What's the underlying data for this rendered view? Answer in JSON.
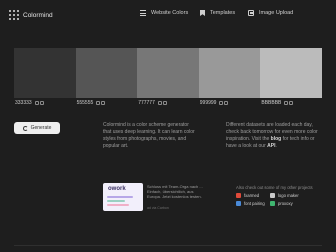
{
  "brand": {
    "name": "Colormind"
  },
  "nav": [
    {
      "label": "Website Colors",
      "icon": "list-icon"
    },
    {
      "label": "Templates",
      "icon": "bookmark-icon"
    },
    {
      "label": "Image Upload",
      "icon": "image-icon"
    }
  ],
  "palette": {
    "swatches": [
      {
        "color": "#333333",
        "hex": "333333"
      },
      {
        "color": "#555555",
        "hex": "555555"
      },
      {
        "color": "#777777",
        "hex": "777777"
      },
      {
        "color": "#999999",
        "hex": "999999"
      },
      {
        "color": "#BBBBBB",
        "hex": "BBBBBB"
      }
    ]
  },
  "generate": {
    "label": "Generate",
    "icon": "refresh-icon"
  },
  "description": {
    "left": "Colormind is a color scheme generator that uses deep learning. It can learn color styles from photographs, movies, and popular art.",
    "right_pre": "Different datasets are loaded each day, check back tomorrow for even more color inspiration. Visit the ",
    "right_blog": "blog",
    "right_mid": " for tech info or have a look at our ",
    "right_api": "API",
    "right_post": "."
  },
  "ad": {
    "logo": "owork",
    "text": "Schluss mit Team-Orga nach ... Einfach, übersichtlich, aus Europa. Jetzt kostenlos testen.",
    "label": "ad via Carbon"
  },
  "projects": {
    "heading": "Also check out some of my other projects",
    "items": [
      {
        "label": "fxarmed",
        "icon": "fxarmed-icon",
        "color": "#e04a3a"
      },
      {
        "label": "logo maker",
        "icon": "logo-maker-icon",
        "color": "#c9c9c9"
      },
      {
        "label": "font pairing",
        "icon": "font-pairing-icon",
        "color": "#4a8ad8"
      },
      {
        "label": "proxoxy",
        "icon": "proxoxy-icon",
        "color": "#3fb56f"
      }
    ]
  }
}
